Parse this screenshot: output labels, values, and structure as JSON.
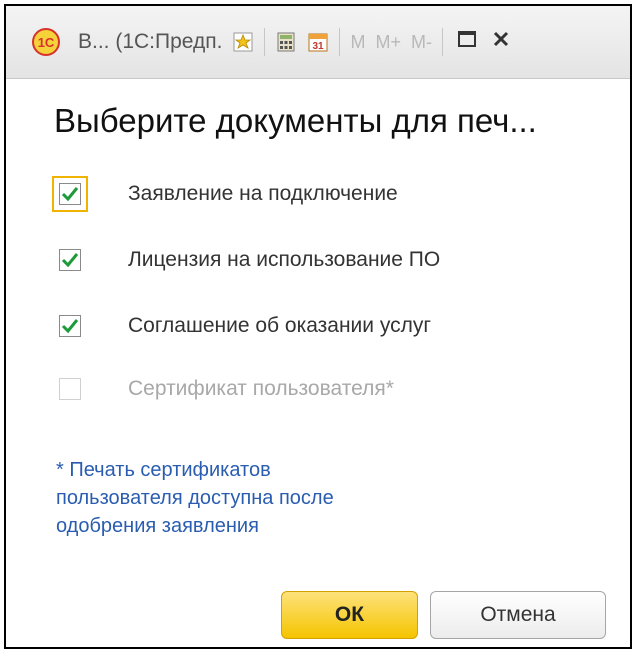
{
  "window": {
    "title": "В... (1С:Предп.",
    "logo_text": "1С",
    "toolbar": {
      "m_label": "M",
      "m_plus_label": "M+",
      "m_minus_label": "M-",
      "maximize_icon": "maximize-icon",
      "close_icon": "close-icon",
      "calendar_day": "31"
    }
  },
  "dialog": {
    "heading": "Выберите документы для печ...",
    "options": [
      {
        "label": "Заявление на подключение",
        "checked": true,
        "enabled": true,
        "focused": true
      },
      {
        "label": "Лицензия на использование ПО",
        "checked": true,
        "enabled": true,
        "focused": false
      },
      {
        "label": "Соглашение об оказании услуг",
        "checked": true,
        "enabled": true,
        "focused": false
      },
      {
        "label": "Сертификат пользователя*",
        "checked": false,
        "enabled": false,
        "focused": false
      }
    ],
    "note_lines": [
      "* Печать сертификатов",
      "пользователя доступна после",
      "одобрения заявления"
    ],
    "ok_label": "ОК",
    "cancel_label": "Отмена"
  },
  "colors": {
    "check": "#1e9a3a",
    "note": "#2a5db0",
    "ok_button": "#f5c400",
    "focus": "#f0b400"
  }
}
